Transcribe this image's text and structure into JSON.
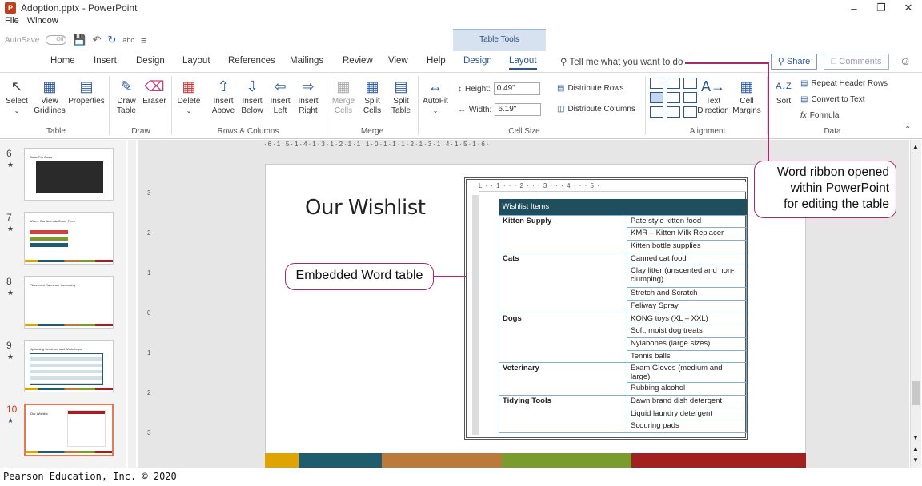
{
  "window": {
    "title": "Adoption.pptx - PowerPoint",
    "app_icon": "P",
    "controls": [
      "minimize-icon",
      "restore-icon",
      "close-icon"
    ]
  },
  "menu": [
    "File",
    "Window"
  ],
  "qat": {
    "autosave": "AutoSave",
    "toggle": "Off"
  },
  "contextual": "Table Tools",
  "tabs": [
    "Home",
    "Insert",
    "Design",
    "Layout",
    "References",
    "Mailings",
    "Review",
    "View",
    "Help",
    "Design",
    "Layout"
  ],
  "tell_me": "Tell me what you want to do",
  "share": "Share",
  "comments": "Comments",
  "ribbon": {
    "buttons": {
      "select": "Select",
      "view_gridlines_1": "View",
      "view_gridlines_2": "Gridlines",
      "properties": "Properties",
      "draw_table_1": "Draw",
      "draw_table_2": "Table",
      "eraser": "Eraser",
      "delete": "Delete",
      "insert_above_1": "Insert",
      "insert_above_2": "Above",
      "insert_below_1": "Insert",
      "insert_below_2": "Below",
      "insert_left_1": "Insert",
      "insert_left_2": "Left",
      "insert_right_1": "Insert",
      "insert_right_2": "Right",
      "merge_cells_1": "Merge",
      "merge_cells_2": "Cells",
      "split_cells_1": "Split",
      "split_cells_2": "Cells",
      "split_table_1": "Split",
      "split_table_2": "Table",
      "autofit": "AutoFit",
      "height_label": "Height:",
      "height_value": "0.49\"",
      "width_label": "Width:",
      "width_value": "6.19\"",
      "distribute_rows": "Distribute Rows",
      "distribute_columns": "Distribute Columns",
      "text_direction_1": "Text",
      "text_direction_2": "Direction",
      "cell_margins_1": "Cell",
      "cell_margins_2": "Margins",
      "sort": "Sort",
      "repeat_header_rows": "Repeat Header Rows",
      "convert_to_text": "Convert to Text",
      "formula": "Formula"
    },
    "groups": {
      "table": "Table",
      "draw": "Draw",
      "rows_columns": "Rows & Columns",
      "merge": "Merge",
      "cell_size": "Cell Size",
      "alignment": "Alignment",
      "data": "Data"
    }
  },
  "slides": [
    {
      "num": "6",
      "title": "Basic Pet Costs"
    },
    {
      "num": "7",
      "title": "Where Our Animals Come From"
    },
    {
      "num": "8",
      "title": "Placement Rates are Increasing"
    },
    {
      "num": "9",
      "title": "Upcoming Seminars and Workshops"
    },
    {
      "num": "10",
      "title": "Our Wishlist"
    }
  ],
  "star": "★",
  "rulers": {
    "horizontal": "·6·1·5·1·4·1·3·1·2·1·1·1·0·1·1·1·2·1·3·1·4·1·5·1·6·",
    "embed": "L · · 1 · · · 2 · · · 3 · · · 4 · · · 5 ·"
  },
  "slide": {
    "title": "Our Wishlist",
    "bar_colors": [
      "#e0a400",
      "#1f5d6e",
      "#b97a3a",
      "#7a9b2e",
      "#a32020"
    ]
  },
  "table": {
    "header": "Wishlist Items",
    "groups": [
      {
        "category": "Kitten Supply",
        "items": [
          "Pate style kitten food",
          "KMR – Kitten Milk Replacer",
          "Kitten bottle supplies"
        ]
      },
      {
        "category": "Cats",
        "items": [
          "Canned cat food",
          "Clay litter (unscented and non-clumping)",
          "Stretch and Scratch",
          "Feliway Spray"
        ]
      },
      {
        "category": "Dogs",
        "items": [
          "KONG toys (XL – XXL)",
          "Soft, moist dog treats",
          "Nylabones (large sizes)",
          "Tennis balls"
        ]
      },
      {
        "category": "Veterinary",
        "items": [
          "Exam Gloves (medium and large)",
          "Rubbing alcohol"
        ]
      },
      {
        "category": "Tidying Tools",
        "items": [
          "Dawn brand dish detergent",
          "Liquid laundry detergent",
          "Scouring pads"
        ]
      }
    ]
  },
  "callouts": {
    "embedded": "Embedded Word table",
    "ribbon_1": "Word ribbon opened",
    "ribbon_2": "within PowerPoint",
    "ribbon_3": "for editing the table"
  },
  "footer": "Pearson Education, Inc. © 2020"
}
